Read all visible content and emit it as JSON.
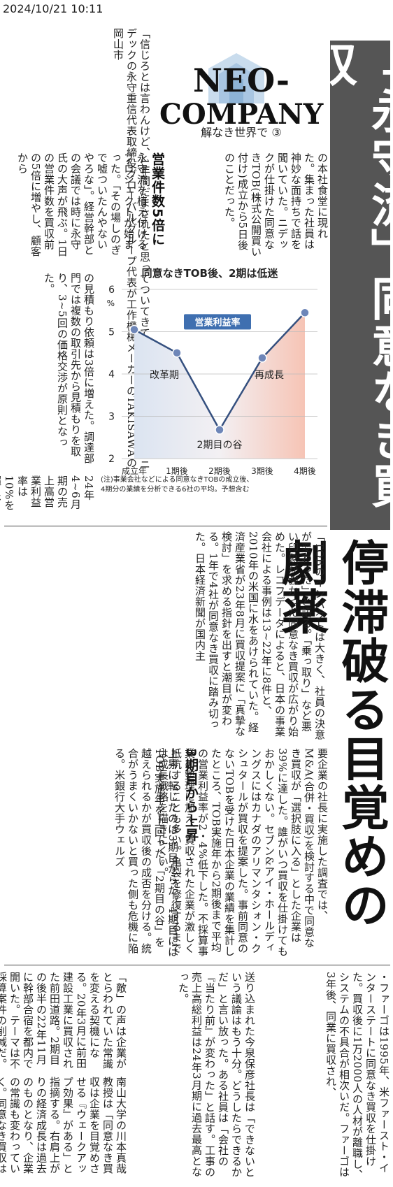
{
  "timestamp": "2024/10/21 10:11",
  "headline_box": "「永守流」同意なき買収",
  "headline_main": "停滞破る目覚めの劇薬",
  "logo": {
    "line1": "NEO-",
    "line2": "COMPANY"
  },
  "series": "解なき世界で ③",
  "subheads": {
    "s1": "営業件数5倍に",
    "s2": "3期目から上昇"
  },
  "chart_data": {
    "type": "line",
    "title": "同意なきTOB後、2期は低迷",
    "ylabel": "%",
    "series_label": "営業利益率",
    "categories": [
      "成立年",
      "1期後",
      "2期後",
      "3期後",
      "4期後"
    ],
    "values": [
      5.05,
      4.5,
      2.68,
      4.38,
      5.45
    ],
    "ylim": [
      2,
      6
    ],
    "yticks": [
      "2",
      "3",
      "4",
      "5",
      "6"
    ],
    "annotations": [
      "改革期",
      "2期目の谷",
      "再成長"
    ],
    "note_line1": "(注)事業会社などによる同意なきTOBの成立後、",
    "note_line2": "4期分の業績を分析できる6社の平均。予想含む"
  },
  "body": {
    "c1": "の本社食堂に現れた。集まった社員は神妙な面持ちで話を聞いていた。ニデックが仕掛けた同意なきTOB(株式公開買い付け)成立から5日後のことだった。",
    "c2": "「信じろとは言わんけど、1年間だまされたと思ってついてきてください」。23年11月、ニデックの永守重信代表取締役グローバルグループ代表が工作機械メーカーのTAKISAWAの岡山市",
    "c3": "永守流を植え付けるプロジェクトが始まった。「その場しのぎで嘘ついたんやないやろな」。経営幹部との会議では時に永守氏の大声が飛ぶ。1日の営業件数を買収前の5倍に増やし、顧客から",
    "c4": "の見積もり依頼は3倍に増えた。調達部門では複数の取引先から見積もりを取り、3~5回の価格交渉が原則となった。",
    "c5": "24年4~6月期の売上高営業利益率は10%を超え、前年同期の赤字から転換した。TAKISAWAの原田一八社長は",
    "c6": "「TOBのインパクトは大きく、社員の決意が変わった」と語る。「乗っ取り」など悪い印象が強かった同意なき買収が広がり始めた。レコフデータによると、日本の事業会社による事例は13~22年に8件と、2010年の米国に水をあけられていた。経済産業省が23年8月に買収提案に「真摯な検討」を求める指針を出すと潮目が変わる。1年で4社が同意なき買収に踏み切った。日本経済新聞が国内主",
    "c7": "要企業の社長に実施した調査では、M&A(合併・買収)を検討する中で同意なき買収が「選択肢に入る」とした企業は39%に達した。誰がいつ買収を仕掛けてもおかしくない。セブン&アイ・ホールディングスにはカナダのアリマンタシォン・クシュタールが買収を提案した。事前同意のないTOBを受けた日本企業の業績を集計したところ、TOB実施年から2期後まで平均の営業利益率が2・4%低下した。不採算事業の整理に加え、買収された企業が激しく抵抗することも多い。亀裂を修復するまでは成長戦略を描きにくい。",
    "c8": "上昇に転じたのは3期目からだ。4期目にはTOB実施年を上回った。「2期目の谷」を越えられるかが買収後の成否を分ける。統合がうまくいかないと買った側も危機に陥る。米銀行大手ウェルズ",
    "c9": "・ファーゴは1995年、米ファースト・インターステートに同意なき買収を仕掛けた。買収後に1万2000人の人材が離職し、システムの不具合が相次いだ。ファーゴは3年後、同業に買収され、",
    "c10": "送り込まれた今泉保彦社長は「できないという議論はもう十分。どうしたらできるかだ」と言い放った。ある社員は「会社の『当たり前』が変わった」と話す。工事の売上高総利益は24年3月期に過去最高となった。",
    "c11": "「敵」の声は企業がとらわれていた常識を変える契機になる。20年3月に前田建設工業に買収された前田道路。2期目の後半の22年11月に幹部合宿を都内で開いた。テーマは不採算案件の削減だ。売上高を最重要と考えてきた前田道路の幹部らは「顧客を失う」と反論する。新たな親会社から",
    "c12": "南山大学の川本真哉教授は「同意なき買収は企業を目覚めさせる『ウェークアップ効果』がある」と指摘する。右肩上がりの経済成長は過去のものとなり、企業の常識も変わっていく。同意なき買収は絶望ではない。「敵」を受け入れるか拒否するかにかかわらず、目覚めの劇薬となる。"
  }
}
